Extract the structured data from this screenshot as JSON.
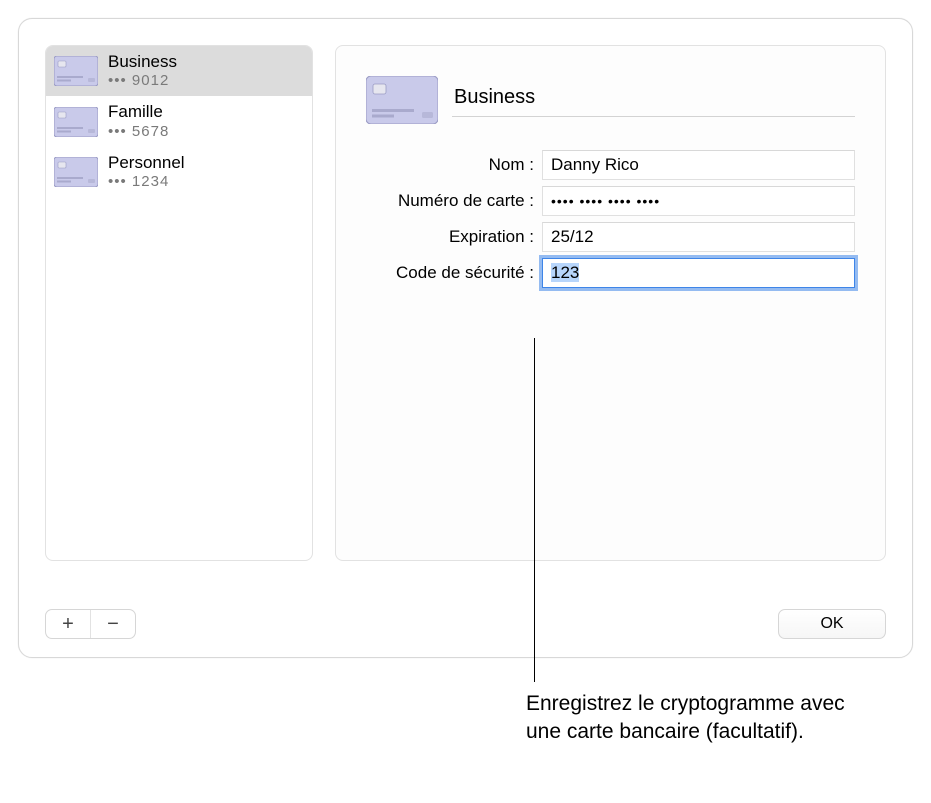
{
  "sidebar": {
    "items": [
      {
        "title": "Business",
        "masked": "••• 9012",
        "selected": true
      },
      {
        "title": "Famille",
        "masked": "••• 5678",
        "selected": false
      },
      {
        "title": "Personnel",
        "masked": "••• 1234",
        "selected": false
      }
    ]
  },
  "detail": {
    "title_value": "Business",
    "rows": {
      "name": {
        "label": "Nom :",
        "value": "Danny Rico"
      },
      "number": {
        "label": "Numéro de carte :",
        "value": "•••• •••• •••• ••••"
      },
      "expiry": {
        "label": "Expiration :",
        "value": "25/12"
      },
      "cvc": {
        "label": "Code de sécurité :",
        "value": "123"
      }
    }
  },
  "buttons": {
    "add": "+",
    "remove": "−",
    "ok": "OK"
  },
  "callout": "Enregistrez le cryptogramme avec une carte bancaire (facultatif)."
}
